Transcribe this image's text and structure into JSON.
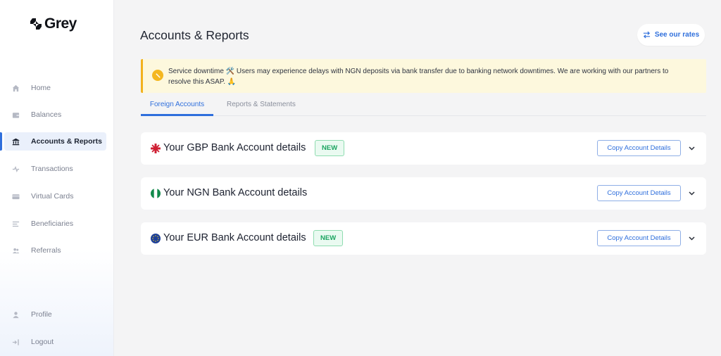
{
  "brand": {
    "name": "Grey"
  },
  "sidebar": {
    "items": [
      {
        "label": "Home",
        "icon": "home-icon"
      },
      {
        "label": "Balances",
        "icon": "wallet-icon"
      },
      {
        "label": "Accounts & Reports",
        "icon": "bank-icon",
        "active": true
      },
      {
        "label": "Transactions",
        "icon": "transactions-icon"
      },
      {
        "label": "Virtual Cards",
        "icon": "card-icon"
      },
      {
        "label": "Beneficiaries",
        "icon": "list-icon"
      },
      {
        "label": "Referrals",
        "icon": "users-icon"
      }
    ],
    "bottom": [
      {
        "label": "Profile",
        "icon": "user-icon"
      },
      {
        "label": "Logout",
        "icon": "logout-icon"
      }
    ]
  },
  "header": {
    "title": "Accounts & Reports",
    "rates_label": "See our rates"
  },
  "banner": {
    "text": "Service downtime 🛠️ Users may experience delays with NGN deposits via bank transfer due to banking network downtimes. We are working with our partners to resolve this ASAP. 🙏",
    "icon": "warning-icon"
  },
  "tabs": [
    {
      "label": "Foreign Accounts",
      "active": true
    },
    {
      "label": "Reports & Statements",
      "active": false
    }
  ],
  "accounts": [
    {
      "title": "Your GBP Bank Account details",
      "badge": "NEW",
      "button": "Copy Account Details",
      "flag": "uk-flag-icon"
    },
    {
      "title": "Your NGN Bank Account details",
      "badge": "",
      "button": "Copy Account Details",
      "flag": "nigeria-flag-icon"
    },
    {
      "title": "Your EUR Bank Account details",
      "badge": "NEW",
      "button": "Copy Account Details",
      "flag": "eu-flag-icon"
    }
  ],
  "colors": {
    "accent": "#2f6fdc",
    "warning": "#f4b720",
    "badge_green": "#1ba460"
  }
}
